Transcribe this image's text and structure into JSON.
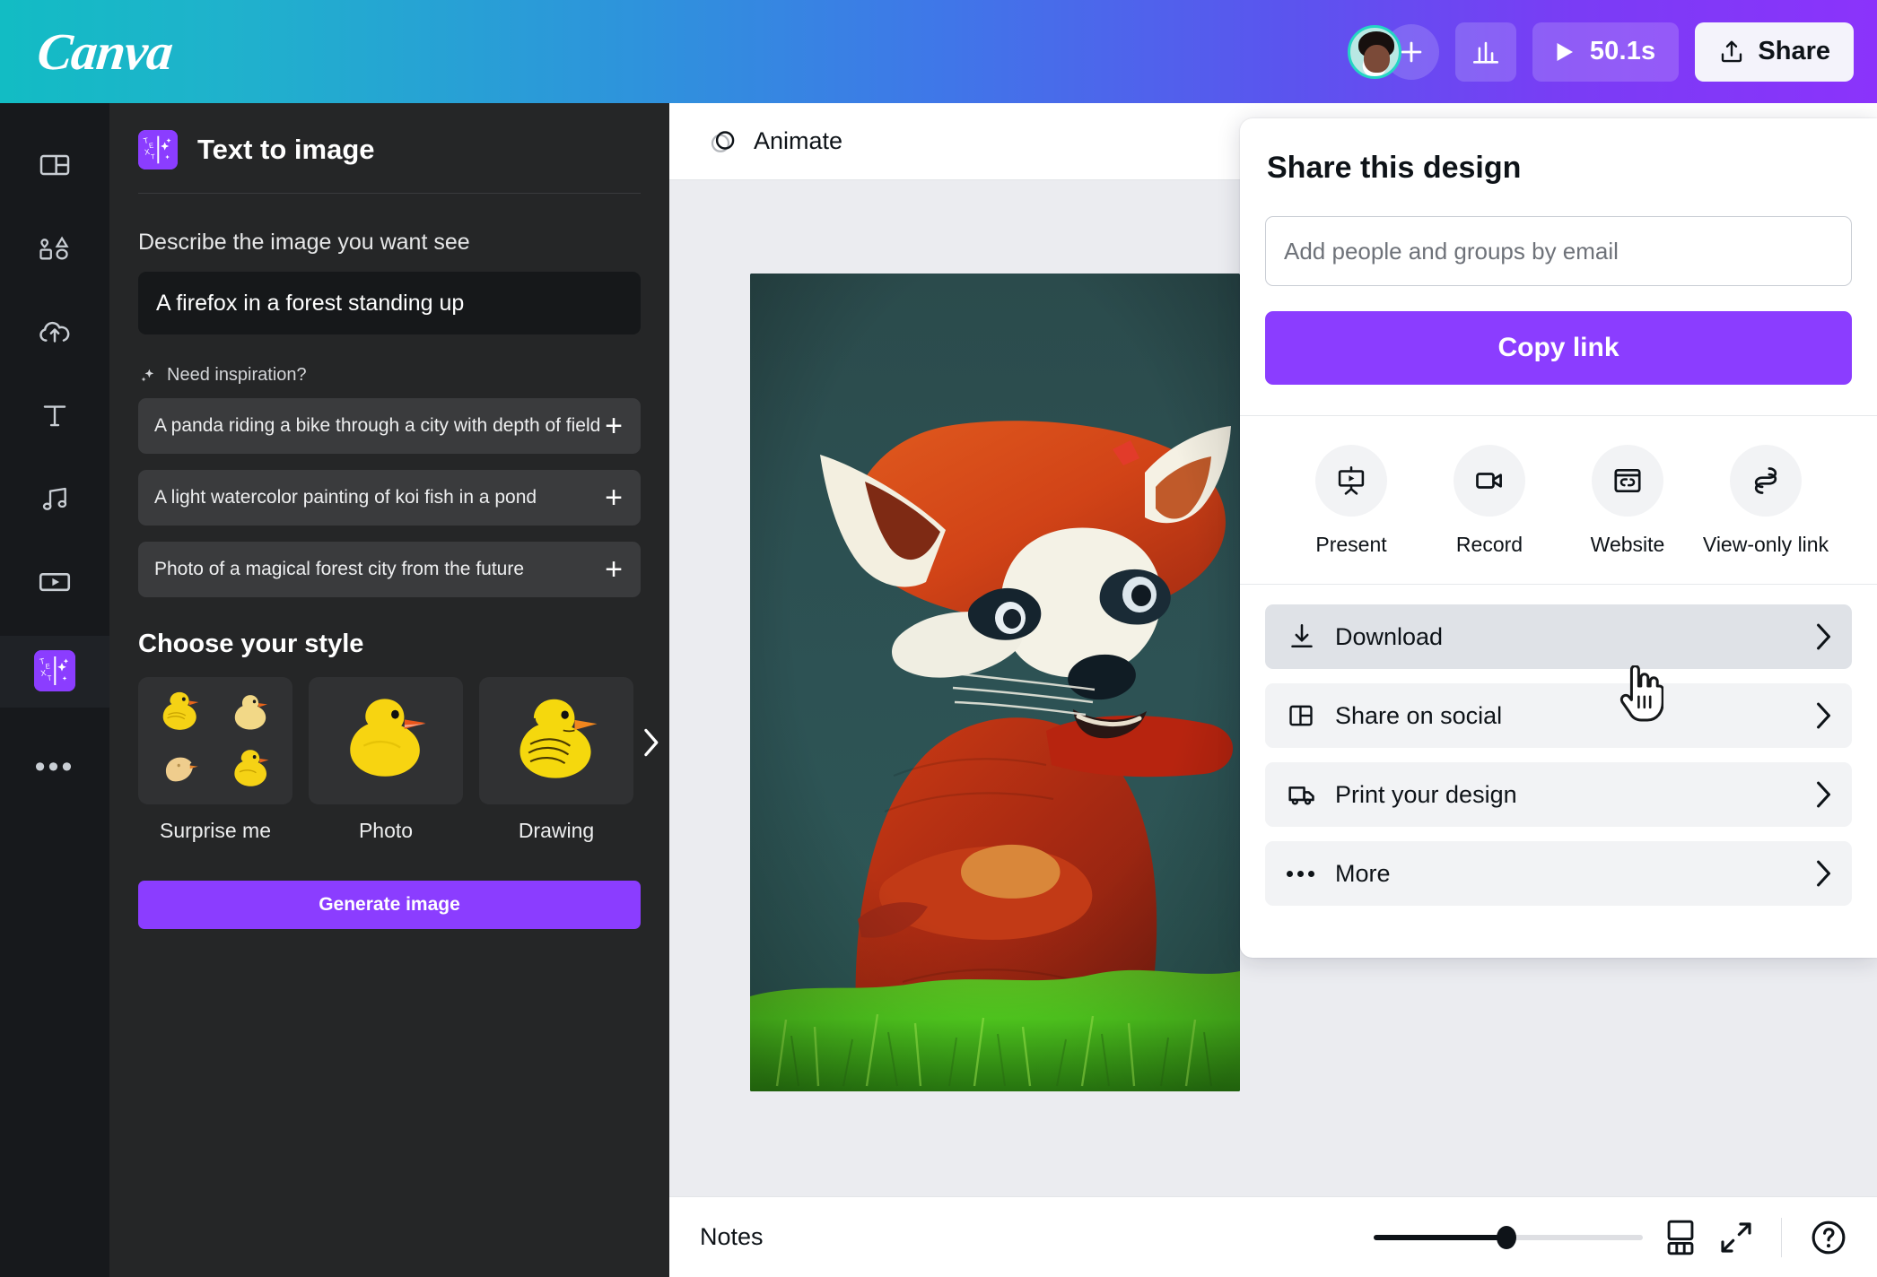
{
  "header": {
    "logo_text": "Canva",
    "avatar_name": "user-avatar",
    "add_collaborator_icon": "plus-icon",
    "stats_icon": "bar-chart-icon",
    "play_icon": "play-icon",
    "duration": "50.1s",
    "share_label": "Share",
    "share_icon": "upload-icon",
    "gradient_from": "#12BCC4",
    "gradient_to": "#8B33FB"
  },
  "rail": {
    "items": [
      {
        "name": "design",
        "icon": "layout-icon"
      },
      {
        "name": "elements",
        "icon": "shapes-icon"
      },
      {
        "name": "uploads",
        "icon": "cloud-upload-icon"
      },
      {
        "name": "text",
        "icon": "text-t-icon"
      },
      {
        "name": "audio",
        "icon": "music-note-icon"
      },
      {
        "name": "videos",
        "icon": "video-frame-icon"
      }
    ],
    "active_app_icon": "text-to-image-app-icon",
    "more_icon": "ellipsis-icon"
  },
  "panel": {
    "app_icon": "text-to-image-app-icon",
    "title": "Text to image",
    "prompt_label": "Describe the image you want see",
    "prompt_value": "A firefox in a forest standing up",
    "inspiration_icon": "sparkle-icon",
    "inspiration_label": "Need inspiration?",
    "suggestions": [
      {
        "text": "A panda riding a bike through a city with depth of field",
        "add_icon": "plus-icon"
      },
      {
        "text": "A light watercolor painting of koi fish in a pond",
        "add_icon": "plus-icon"
      },
      {
        "text": "Photo of a magical forest city from the future",
        "add_icon": "plus-icon"
      }
    ],
    "style_title": "Choose your style",
    "styles": [
      {
        "label": "Surprise me",
        "thumb": "four-rubber-ducks"
      },
      {
        "label": "Photo",
        "thumb": "photo-rubber-duck"
      },
      {
        "label": "Drawing",
        "thumb": "drawing-rubber-duck"
      }
    ],
    "styles_next_icon": "chevron-right-icon",
    "generate_label": "Generate image",
    "accent_color": "#8B3DFF"
  },
  "workarea": {
    "toolbar": {
      "animate_label": "Animate",
      "animate_icon": "animate-circles-icon"
    },
    "canvas_alt": "red panda standing in a forest on green grass",
    "bottombar": {
      "notes_label": "Notes",
      "zoom_percent": 50,
      "grid_icon": "page-grid-icon",
      "fullscreen_icon": "expand-arrows-icon",
      "help_icon": "question-mark-circle-icon"
    }
  },
  "share_panel": {
    "title": "Share this design",
    "email_placeholder": "Add people and groups by email",
    "email_value": "",
    "copy_link_label": "Copy link",
    "copy_link_color": "#8B3DFF",
    "actions": [
      {
        "label": "Present",
        "icon": "present-screen-icon"
      },
      {
        "label": "Record",
        "icon": "video-camera-icon"
      },
      {
        "label": "Website",
        "icon": "website-window-icon"
      },
      {
        "label": "View-only link",
        "icon": "link-chain-icon"
      }
    ],
    "menu": [
      {
        "label": "Download",
        "icon": "download-arrow-icon",
        "hovered": true
      },
      {
        "label": "Share on social",
        "icon": "social-panels-icon",
        "hovered": false
      },
      {
        "label": "Print your design",
        "icon": "delivery-truck-icon",
        "hovered": false
      },
      {
        "label": "More",
        "icon": "ellipsis-icon",
        "hovered": false
      }
    ],
    "chevron_icon": "chevron-right-icon"
  },
  "cursor": {
    "type": "pointing-hand-cursor"
  }
}
